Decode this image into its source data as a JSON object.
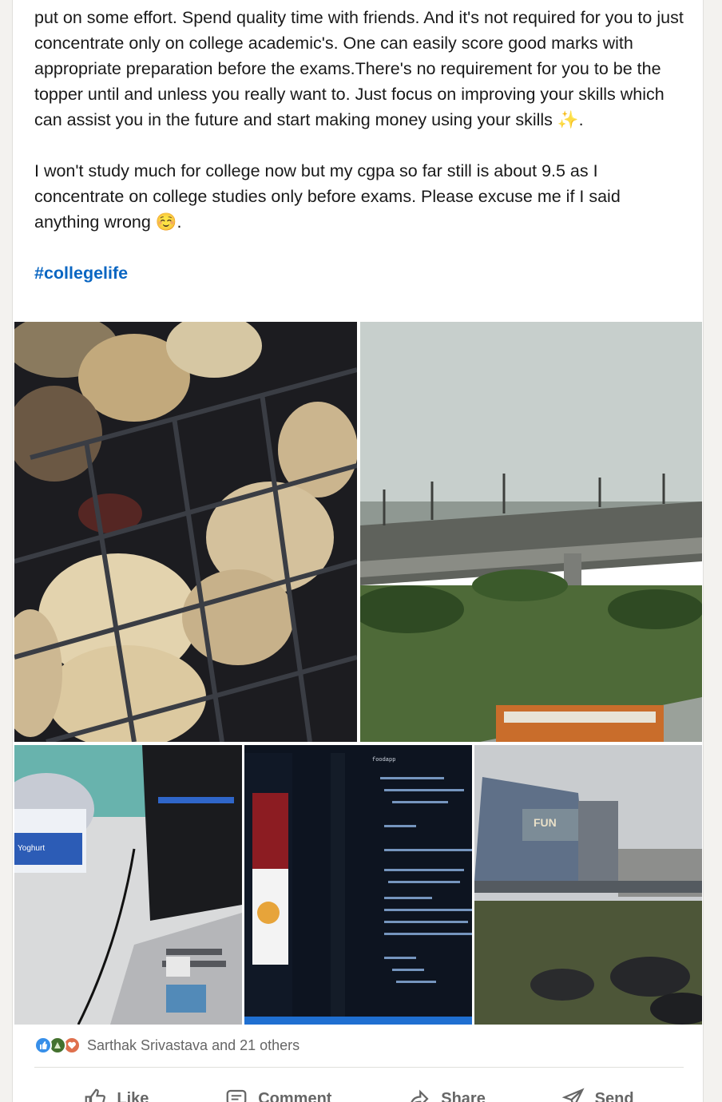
{
  "post": {
    "paragraphs": [
      "put on some effort. Spend quality time with friends. And it's not required for you to just concentrate only on college academic's. One can easily score good marks with appropriate preparation before the exams.There's no requirement for you to be the topper until and unless you really want to. Just focus on improving your skills which can assist you in the future and start making money using your skills ✨.",
      "I won't study much for college now but my cgpa so far still is about 9.5 as I concentrate on college studies only before exams. Please excuse me if I said anything wrong ☺️."
    ],
    "hashtag": "#collegelife"
  },
  "photos": [
    {
      "name": "litti-grill-photo"
    },
    {
      "name": "metro-bridge-photo"
    },
    {
      "name": "laptop-yogurt-photo",
      "visible_text": "Yoghurt"
    },
    {
      "name": "code-screen-photo",
      "visible_text": "foodapp"
    },
    {
      "name": "mall-building-photo",
      "visible_text": "FUN"
    }
  ],
  "reactions": {
    "icons": [
      "like-reaction-icon",
      "celebrate-reaction-icon",
      "love-reaction-icon"
    ],
    "summary": "Sarthak Srivastava and 21 others"
  },
  "actions": {
    "like": "Like",
    "comment": "Comment",
    "share": "Share",
    "send": "Send"
  },
  "colors": {
    "hashtag": "#0a66c2",
    "like": "#378fe9",
    "celebrate": "#44712e",
    "love": "#df704d"
  }
}
